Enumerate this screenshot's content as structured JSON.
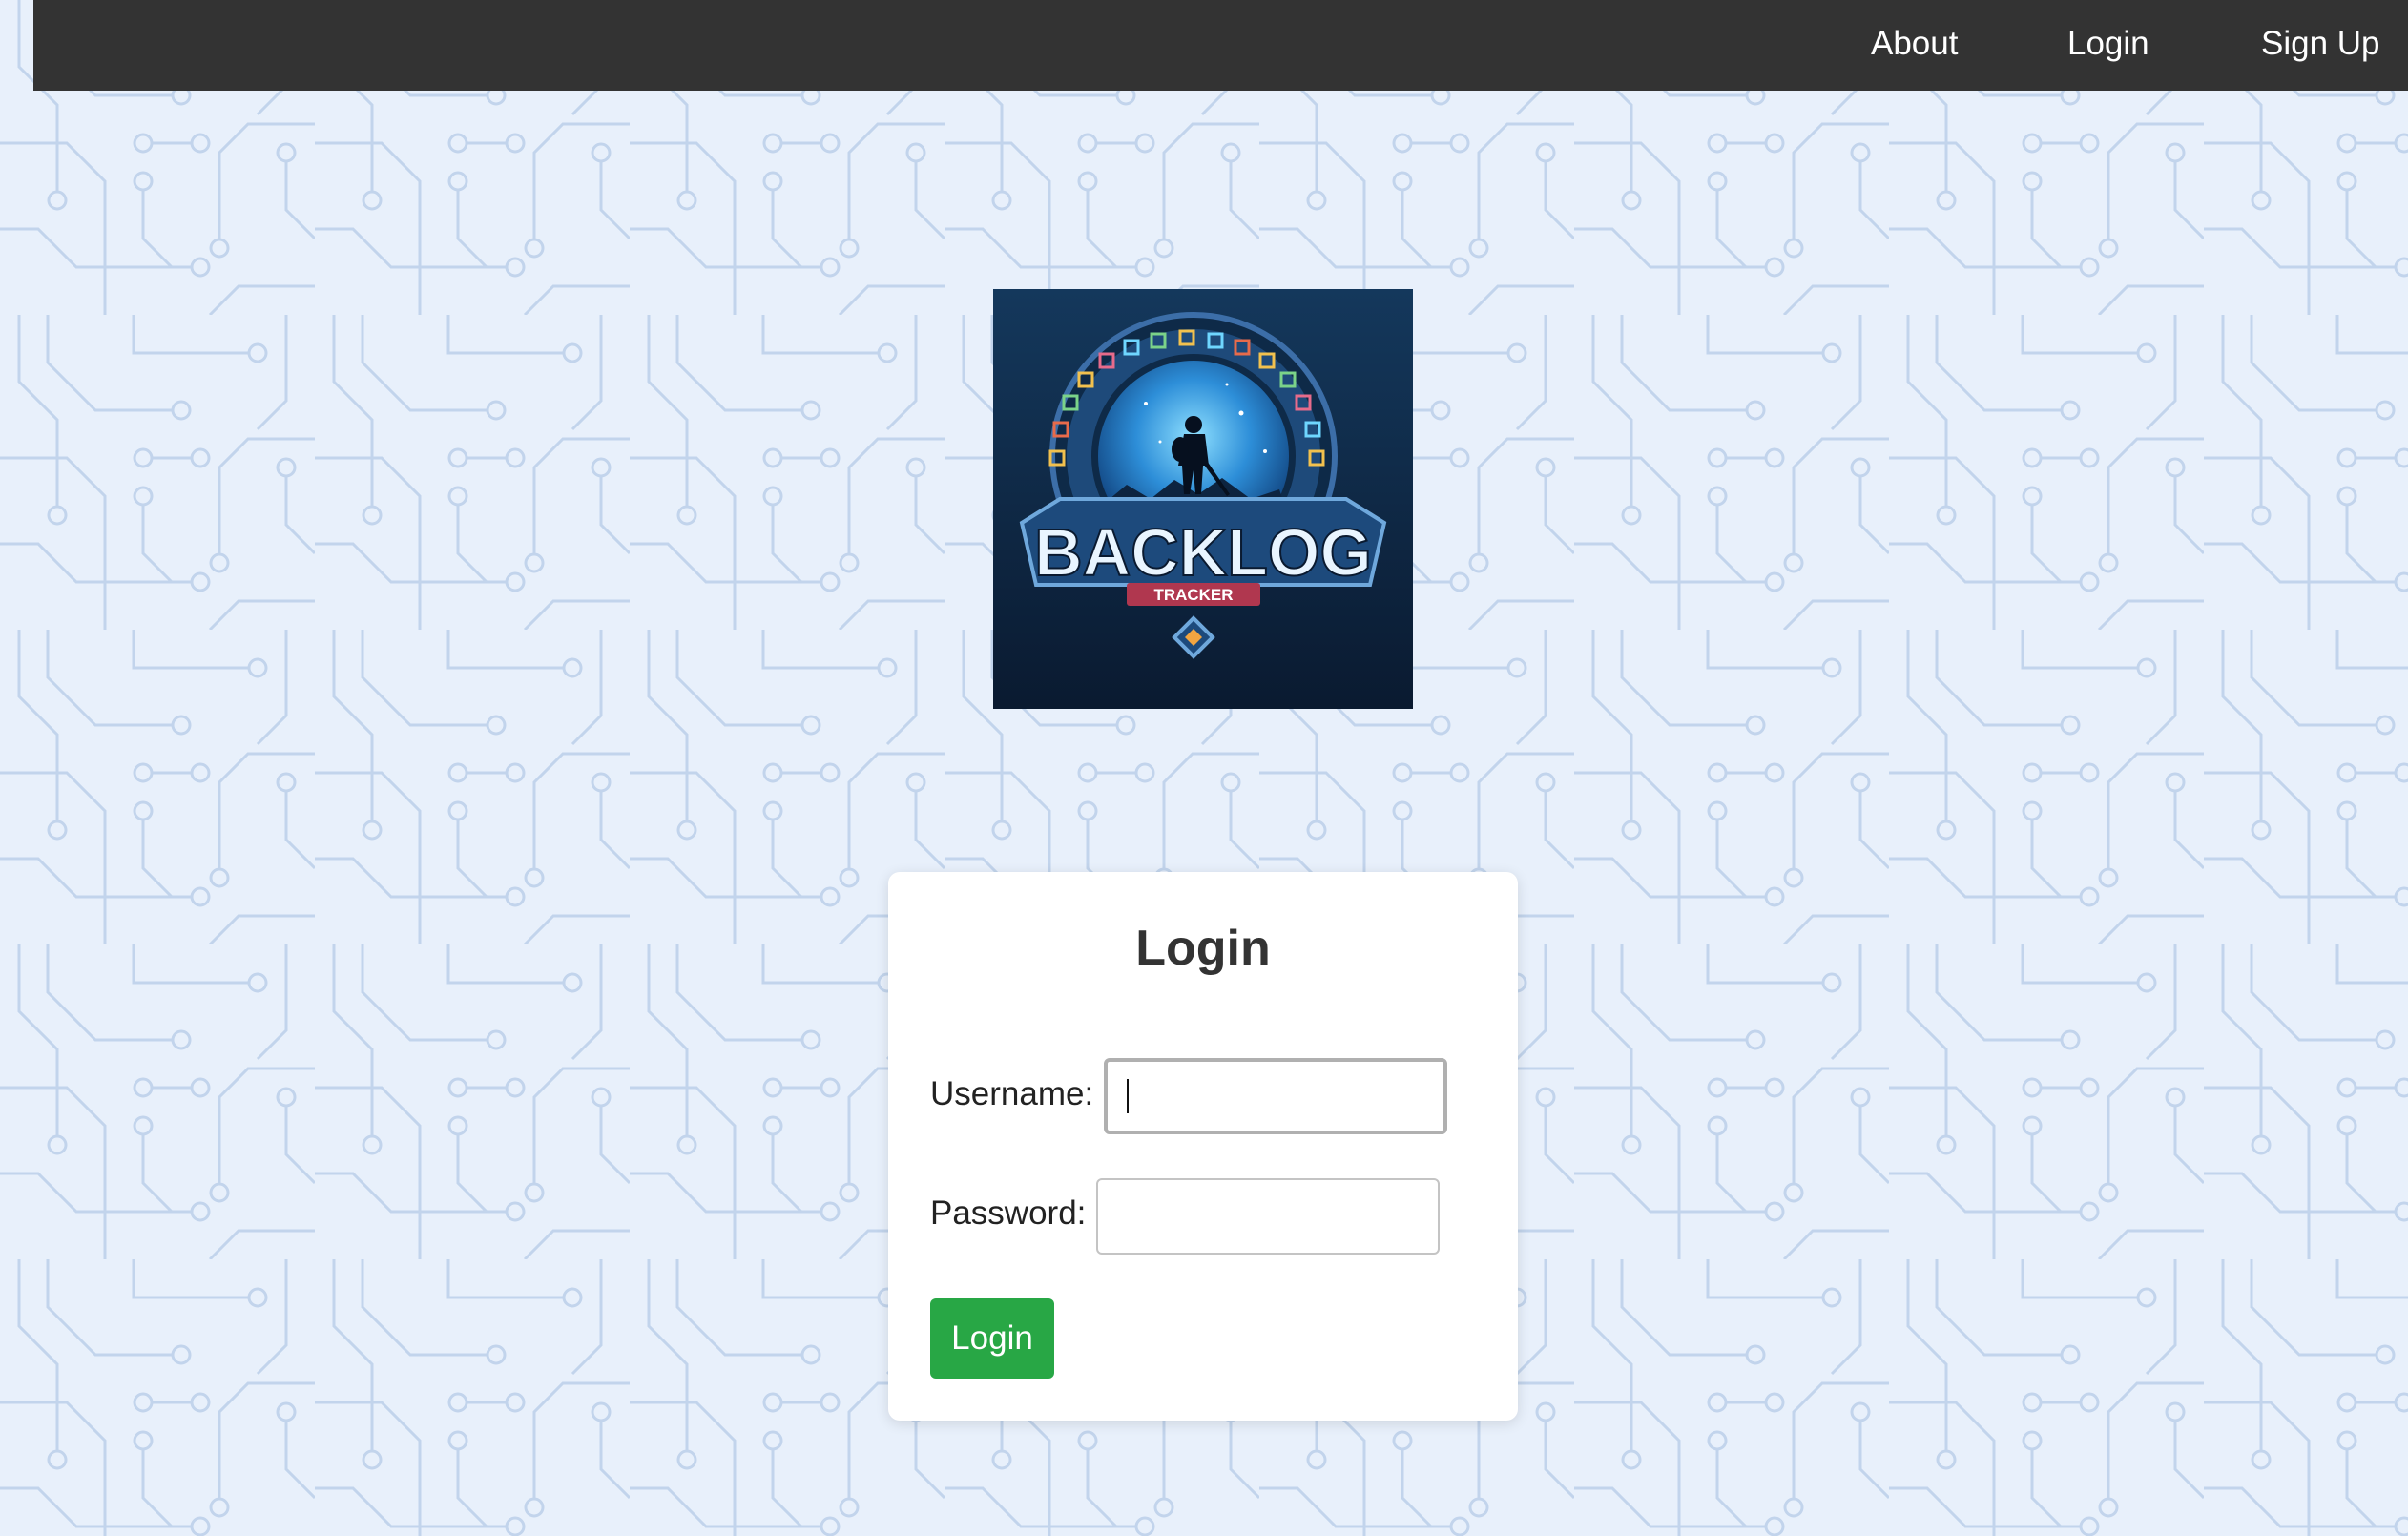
{
  "nav": {
    "about": "About",
    "login": "Login",
    "signup": "Sign Up"
  },
  "logo": {
    "title": "BACKLOG",
    "subtitle": "TRACKER"
  },
  "login_form": {
    "title": "Login",
    "username_label": "Username:",
    "username_value": "",
    "password_label": "Password:",
    "password_value": "",
    "submit_label": "Login"
  },
  "colors": {
    "navbar_bg": "#333333",
    "page_bg": "#e8f0fb",
    "circuit_lines": "#c2d4ec",
    "button_bg": "#28a745"
  }
}
